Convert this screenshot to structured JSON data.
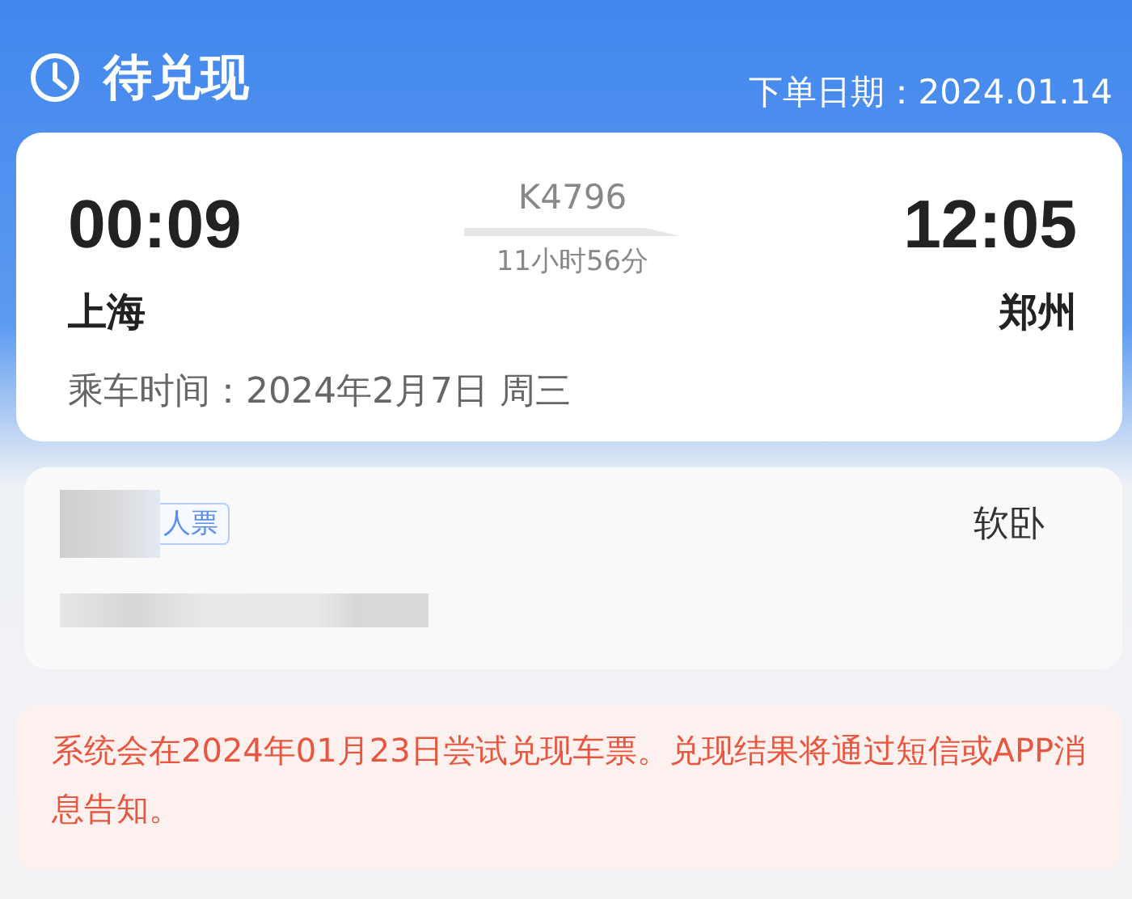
{
  "header": {
    "status": "待兑现",
    "order_date": "下单日期：2024.01.14"
  },
  "trip": {
    "depart_time": "00:09",
    "arrive_time": "12:05",
    "train": "K4796",
    "duration": "11小时56分",
    "from": "上海",
    "to": "郑州",
    "ride_time": "乘车时间：2024年2月7日 周三"
  },
  "passenger": {
    "ticket_type": "人票",
    "seat": "软卧"
  },
  "notice": "系统会在2024年01月23日尝试兑现车票。兑现结果将通过短信或APP消息告知。"
}
